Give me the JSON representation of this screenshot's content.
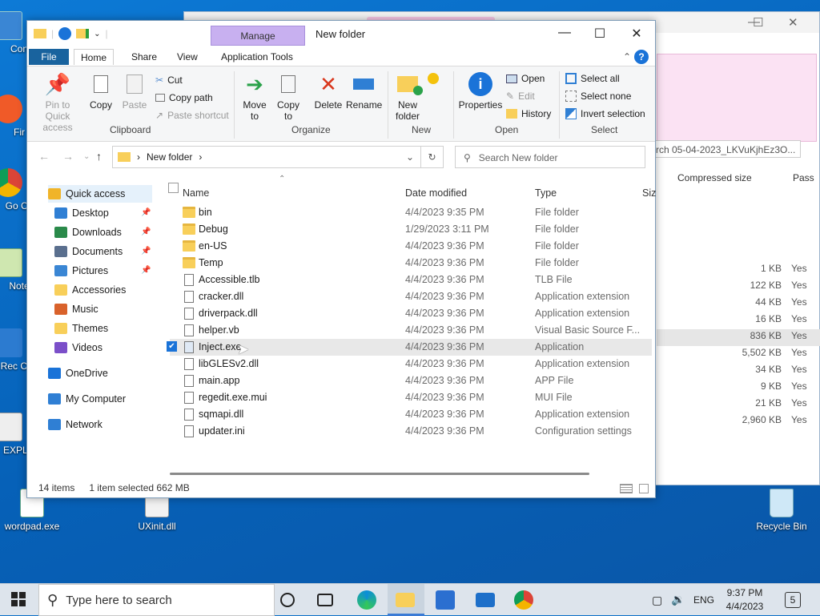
{
  "desktop": {
    "icons": [
      {
        "label": "wordpad.exe"
      },
      {
        "label": "UXinit.dll"
      },
      {
        "label": "Recycle Bin"
      }
    ],
    "partial_labels": [
      "Con",
      "Fir",
      "Go Chr",
      "Note",
      "Rec Con",
      "EXPLO"
    ]
  },
  "back_window": {
    "search_text": "rch 05-04-2023_LKVuKjhEz3O...",
    "headers": {
      "compressed": "Compressed size",
      "pass": "Pass"
    },
    "rows": [
      {
        "size": "1 KB",
        "pass": "Yes"
      },
      {
        "size": "122 KB",
        "pass": "Yes"
      },
      {
        "size": "44 KB",
        "pass": "Yes"
      },
      {
        "size": "16 KB",
        "pass": "Yes"
      },
      {
        "size": "836 KB",
        "pass": "Yes"
      },
      {
        "size": "5,502 KB",
        "pass": "Yes"
      },
      {
        "size": "34 KB",
        "pass": "Yes"
      },
      {
        "size": "9 KB",
        "pass": "Yes"
      },
      {
        "size": "21 KB",
        "pass": "Yes"
      },
      {
        "size": "2,960 KB",
        "pass": "Yes"
      }
    ]
  },
  "window": {
    "title": "New folder",
    "manage_tab": "Manage",
    "tabs": {
      "file": "File",
      "home": "Home",
      "share": "Share",
      "view": "View",
      "app_tools": "Application Tools"
    },
    "ribbon": {
      "pin_quick_access": "Pin to Quick access",
      "copy": "Copy",
      "paste": "Paste",
      "cut": "Cut",
      "copy_path": "Copy path",
      "paste_shortcut": "Paste shortcut",
      "clipboard": "Clipboard",
      "move_to": "Move to",
      "copy_to": "Copy to",
      "delete": "Delete",
      "rename": "Rename",
      "organize": "Organize",
      "new_folder": "New folder",
      "new": "New",
      "properties": "Properties",
      "open": "Open",
      "edit": "Edit",
      "history": "History",
      "open_group": "Open",
      "select_all": "Select all",
      "select_none": "Select none",
      "invert_selection": "Invert selection",
      "select": "Select"
    },
    "address": {
      "path": "New folder",
      "search_placeholder": "Search New folder"
    },
    "nav": [
      {
        "label": "Quick access"
      },
      {
        "label": "Desktop"
      },
      {
        "label": "Downloads"
      },
      {
        "label": "Documents"
      },
      {
        "label": "Pictures"
      },
      {
        "label": "Accessories"
      },
      {
        "label": "Music"
      },
      {
        "label": "Themes"
      },
      {
        "label": "Videos"
      },
      {
        "label": "OneDrive"
      },
      {
        "label": "My Computer"
      },
      {
        "label": "Network"
      }
    ],
    "columns": {
      "name": "Name",
      "date": "Date modified",
      "type": "Type",
      "size": "Siz"
    },
    "files": [
      {
        "name": "bin",
        "date": "4/4/2023 9:35 PM",
        "type": "File folder",
        "kind": "folder"
      },
      {
        "name": "Debug",
        "date": "1/29/2023 3:11 PM",
        "type": "File folder",
        "kind": "folder"
      },
      {
        "name": "en-US",
        "date": "4/4/2023 9:36 PM",
        "type": "File folder",
        "kind": "folder"
      },
      {
        "name": "Temp",
        "date": "4/4/2023 9:36 PM",
        "type": "File folder",
        "kind": "folder"
      },
      {
        "name": "Accessible.tlb",
        "date": "4/4/2023 9:36 PM",
        "type": "TLB File",
        "kind": "file"
      },
      {
        "name": "cracker.dll",
        "date": "4/4/2023 9:36 PM",
        "type": "Application extension",
        "kind": "file"
      },
      {
        "name": "driverpack.dll",
        "date": "4/4/2023 9:36 PM",
        "type": "Application extension",
        "kind": "file"
      },
      {
        "name": "helper.vb",
        "date": "4/4/2023 9:36 PM",
        "type": "Visual Basic Source F...",
        "kind": "file"
      },
      {
        "name": "Inject.exe",
        "date": "4/4/2023 9:36 PM",
        "type": "Application",
        "kind": "app",
        "selected": true
      },
      {
        "name": "libGLESv2.dll",
        "date": "4/4/2023 9:36 PM",
        "type": "Application extension",
        "kind": "file"
      },
      {
        "name": "main.app",
        "date": "4/4/2023 9:36 PM",
        "type": "APP File",
        "kind": "file"
      },
      {
        "name": "regedit.exe.mui",
        "date": "4/4/2023 9:36 PM",
        "type": "MUI File",
        "kind": "file"
      },
      {
        "name": "sqmapi.dll",
        "date": "4/4/2023 9:36 PM",
        "type": "Application extension",
        "kind": "file"
      },
      {
        "name": "updater.ini",
        "date": "4/4/2023 9:36 PM",
        "type": "Configuration settings",
        "kind": "file"
      }
    ],
    "status": {
      "count": "14 items",
      "selected": "1 item selected  662 MB"
    }
  },
  "taskbar": {
    "search_placeholder": "Type here to search",
    "lang": "ENG",
    "time": "9:37 PM",
    "date": "4/4/2023",
    "notifications": "5"
  }
}
